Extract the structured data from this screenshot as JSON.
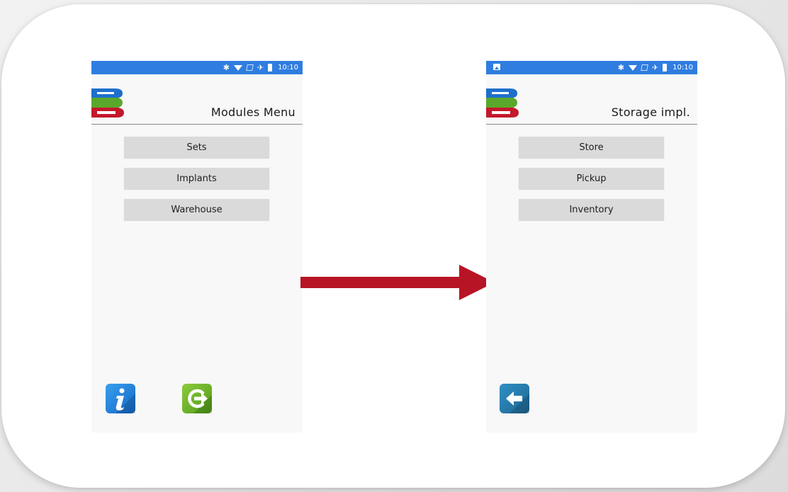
{
  "screens": [
    {
      "title": "Modules Menu",
      "status_time": "10:10",
      "buttons": [
        "Sets",
        "Implants",
        "Warehouse"
      ]
    },
    {
      "title": "Storage impl.",
      "status_time": "10:10",
      "buttons": [
        "Store",
        "Pickup",
        "Inventory"
      ]
    }
  ],
  "colors": {
    "status_bar": "#2f7de0",
    "arrow": "#b71425",
    "logo_blue": "#1e6fcc",
    "logo_green": "#5aa82b",
    "logo_red": "#c4182c"
  },
  "icons": {
    "left_screen_bottom": [
      "info-icon",
      "logout-icon"
    ],
    "right_screen_bottom": [
      "back-arrow-icon"
    ],
    "status_bar": [
      "bluetooth-icon",
      "wifi-icon",
      "no-sim-icon",
      "airplane-icon",
      "battery-icon"
    ]
  }
}
